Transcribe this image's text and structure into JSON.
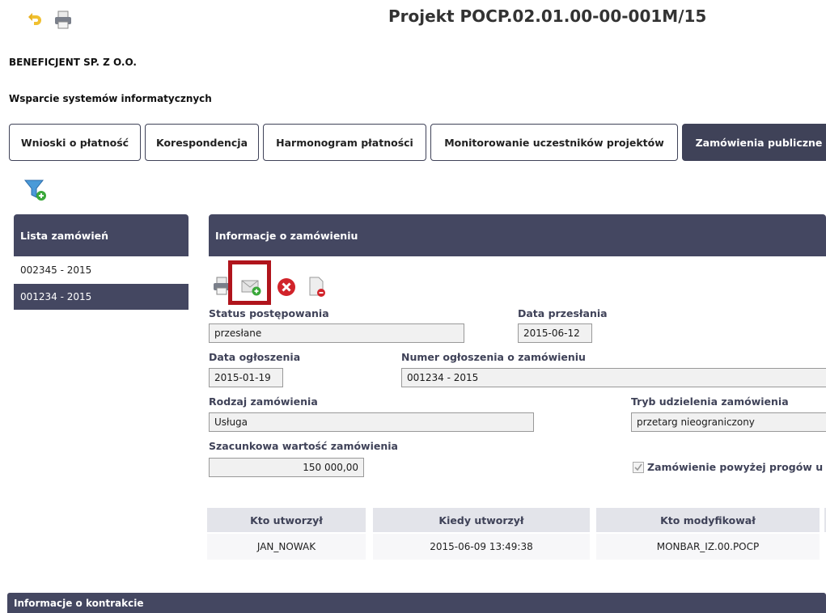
{
  "header": {
    "project_title": "Projekt POCP.02.01.00-00-001M/15",
    "beneficiary": "BENEFICJENT SP. Z O.O.",
    "project_name": "Wsparcie systemów informatycznych"
  },
  "tabs": [
    {
      "label": "Wnioski o płatność"
    },
    {
      "label": "Korespondencja"
    },
    {
      "label": "Harmonogram płatności"
    },
    {
      "label": "Monitorowanie uczestników projektów"
    },
    {
      "label": "Zamówienia publiczne",
      "active": true
    }
  ],
  "sidebar": {
    "title": "Lista zamówień",
    "items": [
      {
        "label": "002345 - 2015"
      },
      {
        "label": "001234 - 2015",
        "selected": true
      }
    ]
  },
  "details": {
    "title": "Informacje o zamówieniu",
    "status_label": "Status postępowania",
    "status_value": "przesłane",
    "sent_date_label": "Data przesłania",
    "sent_date_value": "2015-06-12",
    "announce_date_label": "Data ogłoszenia",
    "announce_date_value": "2015-01-19",
    "announce_number_label": "Numer ogłoszenia o zamówieniu",
    "announce_number_value": "001234 - 2015",
    "type_label": "Rodzaj zamówienia",
    "type_value": "Usługa",
    "mode_label": "Tryb udzielenia zamówienia",
    "mode_value": "przetarg nieograniczony",
    "value_label": "Szacunkowa wartość zamówienia",
    "value_value": "150 000,00",
    "threshold_label": "Zamówienie powyżej progów u",
    "threshold_checked": true
  },
  "audit": {
    "headers": [
      "Kto utworzył",
      "Kiedy utworzył",
      "Kto modyfikował"
    ],
    "row": [
      "JAN_NOWAK",
      "2015-06-09 13:49:38",
      "MONBAR_IZ.00.POCP"
    ]
  },
  "contract": {
    "title": "Informacje o kontrakcie"
  },
  "colors": {
    "header_bg": "#444761",
    "highlight_box": "#b0141c"
  },
  "icons": [
    "back-arrow-icon",
    "printer-icon",
    "filter-add-icon",
    "send-mail-icon",
    "delete-icon",
    "document-remove-icon"
  ]
}
